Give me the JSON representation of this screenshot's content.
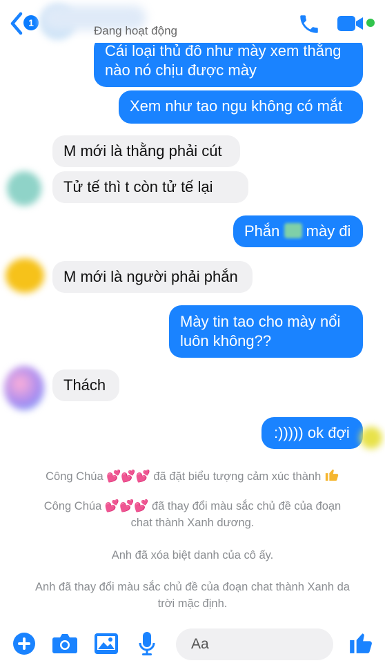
{
  "header": {
    "back_badge": "1",
    "status": "Đang hoạt động",
    "icons": [
      "back-chevron-icon",
      "phone-icon",
      "video-camera-icon"
    ]
  },
  "messages": [
    {
      "side": "out",
      "lines": [
        "Cái loại thủ đô như mày xem thằng",
        "nào nó chịu được mày"
      ]
    },
    {
      "side": "out",
      "lines": [
        "Xem như tao ngu không có mắt"
      ]
    },
    {
      "side": "in",
      "lines": [
        "M mới là thằng phải cút"
      ]
    },
    {
      "side": "in",
      "lines": [
        "Tử tế thì t còn tử tế lại"
      ]
    },
    {
      "side": "out",
      "lines": [
        "Phắn",
        "mày đi"
      ]
    },
    {
      "side": "in",
      "lines": [
        "M mới là người phải phắn"
      ]
    },
    {
      "side": "out",
      "lines": [
        "Mày tin tao cho mày nổi",
        "luôn không??"
      ]
    },
    {
      "side": "in",
      "lines": [
        "Thách"
      ]
    },
    {
      "side": "out",
      "lines": [
        ":))))) ok đợi"
      ]
    }
  ],
  "system_notes": {
    "note1": {
      "name": "Công Chúa",
      "text": "đã đặt biểu tượng cảm xúc thành"
    },
    "note2": {
      "name": "Công Chúa",
      "text": "đã thay đổi màu sắc chủ đề của đoạn",
      "text2": "chat thành Xanh dương."
    },
    "note3": "Anh đã xóa biệt danh của cô ấy.",
    "note4": {
      "line1": "Anh đã thay đổi màu sắc chủ đề của đoạn chat thành Xanh da",
      "line2": "trời mặc định."
    }
  },
  "composer": {
    "placeholder": "Aa",
    "icons": [
      "plus-icon",
      "camera-icon",
      "image-icon",
      "microphone-icon",
      "emoji-icon",
      "thumbs-up-icon"
    ]
  },
  "colors": {
    "accent": "#1a83ff",
    "incoming": "#f0f0f2",
    "system_text": "#8a8d91",
    "online": "#31c44d"
  }
}
